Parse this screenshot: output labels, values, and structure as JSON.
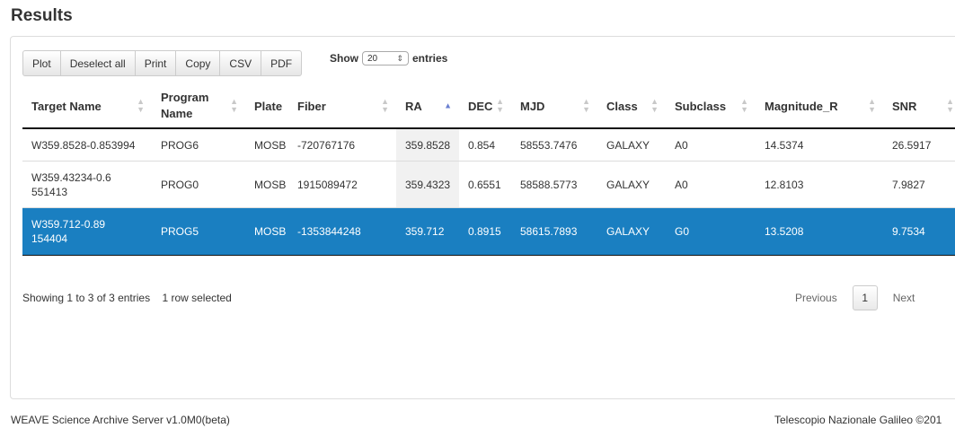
{
  "page_title": "Results",
  "toolbar": {
    "buttons": [
      "Plot",
      "Deselect all",
      "Print",
      "Copy",
      "CSV",
      "PDF"
    ]
  },
  "length_menu": {
    "prefix": "Show",
    "value": "20",
    "suffix": "entries"
  },
  "table": {
    "columns": [
      {
        "label": "Target Name"
      },
      {
        "label": "Program Name"
      },
      {
        "label": "Plate"
      },
      {
        "label": "Fiber"
      },
      {
        "label": "RA",
        "sorted": "asc"
      },
      {
        "label": "DEC"
      },
      {
        "label": "MJD"
      },
      {
        "label": "Class"
      },
      {
        "label": "Subclass"
      },
      {
        "label": "Magnitude_R"
      },
      {
        "label": "SNR"
      }
    ],
    "rows": [
      {
        "cells": [
          "W359.8528-0.853994",
          "PROG6",
          "MOSB",
          "-720767176",
          "359.8528",
          "0.854",
          "58553.7476",
          "GALAXY",
          "A0",
          "14.5374",
          "26.5917"
        ],
        "selected": false
      },
      {
        "cells": [
          "W359.43234-0.6551413",
          "PROG0",
          "MOSB",
          "1915089472",
          "359.4323",
          "0.6551",
          "58588.5773",
          "GALAXY",
          "A0",
          "12.8103",
          "7.9827"
        ],
        "selected": false
      },
      {
        "cells": [
          "W359.712-0.89154404",
          "PROG5",
          "MOSB",
          "-1353844248",
          "359.712",
          "0.8915",
          "58615.7893",
          "GALAXY",
          "G0",
          "13.5208",
          "9.7534"
        ],
        "selected": true
      }
    ]
  },
  "info": {
    "showing": "Showing 1 to 3 of 3 entries",
    "selected": "1 row selected"
  },
  "pagination": {
    "previous": "Previous",
    "current": "1",
    "next": "Next"
  },
  "footer": {
    "left": "WEAVE Science Archive Server v1.0M0(beta)",
    "right": "Telescopio Nazionale Galileo ©201"
  },
  "colors": {
    "selected_row": "#1a7fc1",
    "sort_active": "#6a7fd0"
  }
}
